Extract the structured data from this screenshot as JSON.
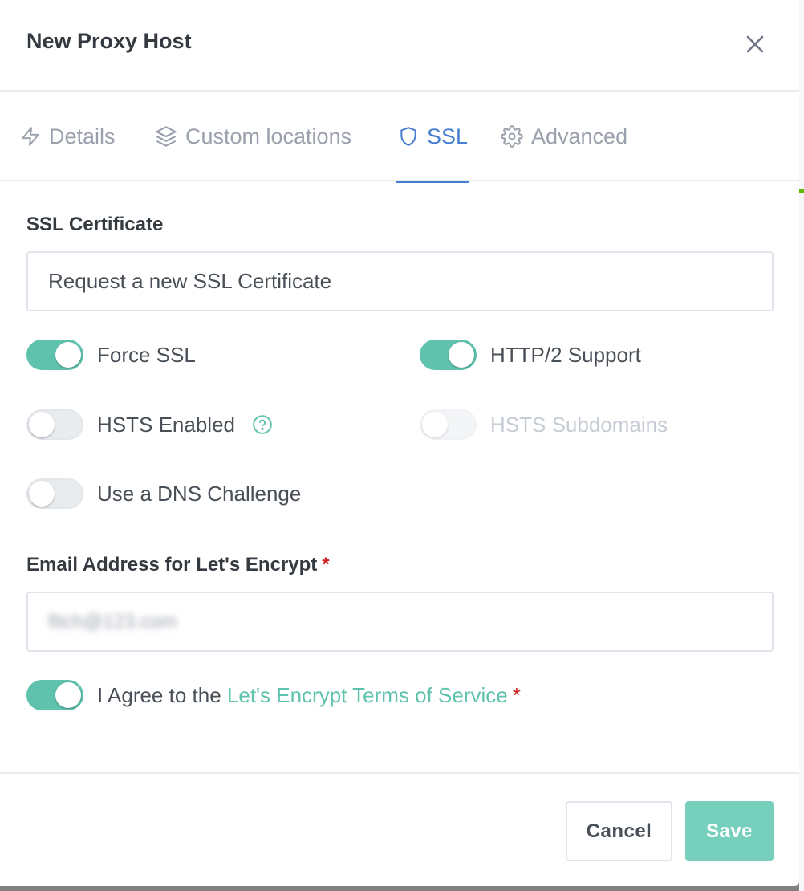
{
  "modal": {
    "title": "New Proxy Host",
    "close_icon": "close-icon"
  },
  "tabs": [
    {
      "label": "Details",
      "icon": "bolt-icon",
      "active": false
    },
    {
      "label": "Custom locations",
      "icon": "layers-icon",
      "active": false
    },
    {
      "label": "SSL",
      "icon": "shield-icon",
      "active": true
    },
    {
      "label": "Advanced",
      "icon": "gear-icon",
      "active": false
    }
  ],
  "ssl": {
    "certificate_label": "SSL Certificate",
    "certificate_value": "Request a new SSL Certificate",
    "force_ssl": {
      "label": "Force SSL",
      "on": true
    },
    "http2": {
      "label": "HTTP/2 Support",
      "on": true
    },
    "hsts": {
      "label": "HSTS Enabled",
      "on": false
    },
    "hsts_subdomains": {
      "label": "HSTS Subdomains",
      "on": false,
      "disabled": true
    },
    "dns_challenge": {
      "label": "Use a DNS Challenge",
      "on": false
    },
    "email_label": "Email Address for Let's Encrypt",
    "required_mark": "*",
    "email_value": "fitch@123.com",
    "agree_prefix": "I Agree to the",
    "agree_link": "Let's Encrypt Terms of Service",
    "agree_on": true
  },
  "footer": {
    "cancel_label": "Cancel",
    "save_label": "Save"
  },
  "colors": {
    "accent": "#5fc2ad",
    "tab_active": "#467fcf",
    "required": "#cd201f"
  }
}
